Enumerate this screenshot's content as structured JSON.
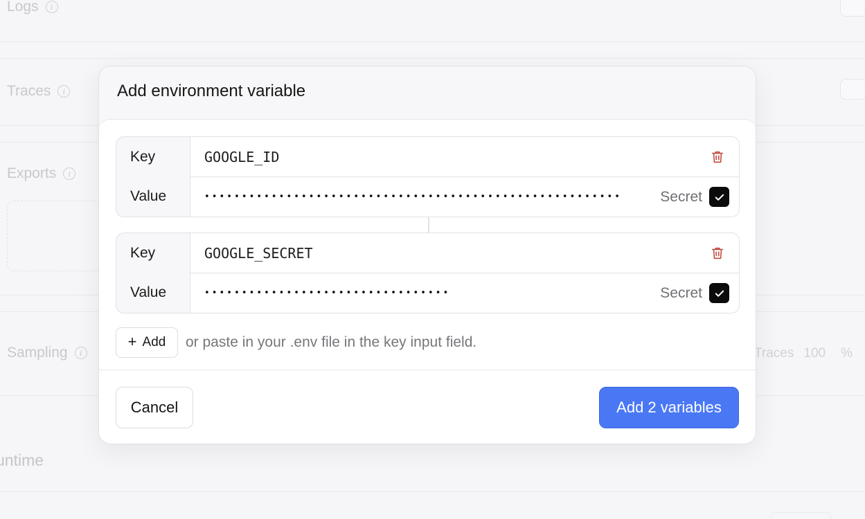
{
  "background": {
    "sections": [
      {
        "label": "Logs"
      },
      {
        "label": "Traces"
      },
      {
        "label": "Exports"
      },
      {
        "label": "Sampling"
      }
    ],
    "sampling_traces_label": "Traces",
    "sampling_traces_value": "100",
    "sampling_traces_unit": "%",
    "runtime_label": "untime",
    "info_glyph": "i"
  },
  "modal": {
    "title": "Add environment variable",
    "key_label": "Key",
    "value_label": "Value",
    "secret_label": "Secret",
    "variables": [
      {
        "key": "GOOGLE_ID",
        "value_masked": "••••••••••••••••••••••••••••••••••••••••••••••••••••••••",
        "secret": true
      },
      {
        "key": "GOOGLE_SECRET",
        "value_masked": "•••••••••••••••••••••••••••••••••",
        "secret": true
      }
    ],
    "add_button": "Add",
    "add_button_icon": "+",
    "hint": "or paste in your .env file in the key input field.",
    "cancel_button": "Cancel",
    "submit_button": "Add 2 variables"
  },
  "colors": {
    "primary": "#4a78f5",
    "danger_icon": "#c0473f",
    "checkbox": "#0b0b0b"
  },
  "icons": {
    "delete": "trash-icon",
    "check": "check-icon",
    "info": "info-icon",
    "add": "plus-icon"
  }
}
